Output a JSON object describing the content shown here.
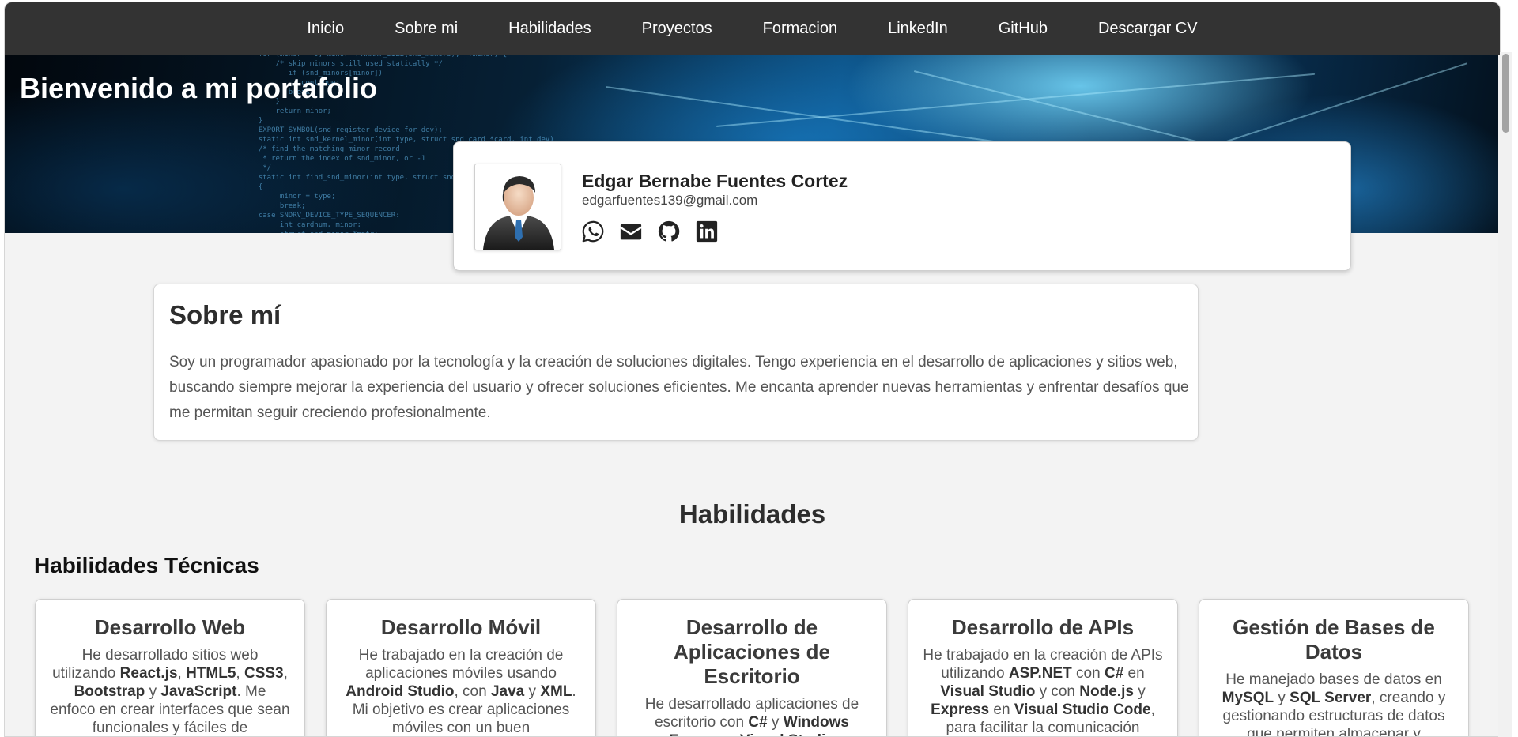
{
  "nav": {
    "items": [
      {
        "label": "Inicio"
      },
      {
        "label": "Sobre mi"
      },
      {
        "label": "Habilidades"
      },
      {
        "label": "Proyectos"
      },
      {
        "label": "Formacion"
      },
      {
        "label": "LinkedIn"
      },
      {
        "label": "GitHub"
      },
      {
        "label": "Descargar CV"
      }
    ]
  },
  "hero": {
    "title": "Bienvenido a mi portafolio"
  },
  "profile": {
    "name": "Edgar Bernabe Fuentes Cortez",
    "email": "edgarfuentes139@gmail.com",
    "social_icons": [
      "whatsapp-icon",
      "email-icon",
      "github-icon",
      "linkedin-icon"
    ]
  },
  "about": {
    "title": "Sobre mí",
    "text": "Soy un programador apasionado por la tecnología y la creación de soluciones digitales. Tengo experiencia en el desarrollo de aplicaciones y sitios web, buscando siempre mejorar la experiencia del usuario y ofrecer soluciones eficientes. Me encanta aprender nuevas herramientas y enfrentar desafíos que me permitan seguir creciendo profesionalmente."
  },
  "skills": {
    "title": "Habilidades",
    "subtitle": "Habilidades Técnicas",
    "cards": [
      {
        "title": "Desarrollo Web",
        "parts": [
          {
            "t": "He desarrollado sitios web utilizando "
          },
          {
            "t": "React.js",
            "b": true
          },
          {
            "t": ", "
          },
          {
            "t": "HTML5",
            "b": true
          },
          {
            "t": ", "
          },
          {
            "t": "CSS3",
            "b": true
          },
          {
            "t": ", "
          },
          {
            "t": "Bootstrap",
            "b": true
          },
          {
            "t": " y "
          },
          {
            "t": "JavaScript",
            "b": true
          },
          {
            "t": ". Me enfoco en crear interfaces que sean funcionales y fáciles de"
          }
        ]
      },
      {
        "title": "Desarrollo Móvil",
        "parts": [
          {
            "t": "He trabajado en la creación de aplicaciones móviles usando "
          },
          {
            "t": "Android Studio",
            "b": true
          },
          {
            "t": ", con "
          },
          {
            "t": "Java",
            "b": true
          },
          {
            "t": " y "
          },
          {
            "t": "XML",
            "b": true
          },
          {
            "t": ". Mi objetivo es crear aplicaciones móviles con un buen"
          }
        ]
      },
      {
        "title": "Desarrollo de Aplicaciones de Escritorio",
        "parts": [
          {
            "t": "He desarrollado aplicaciones de escritorio con "
          },
          {
            "t": "C#",
            "b": true
          },
          {
            "t": " y "
          },
          {
            "t": "Windows",
            "b": true
          },
          {
            "t": " "
          },
          {
            "t": "Forms",
            "b": true
          },
          {
            "t": " en "
          },
          {
            "t": "Visual Studio",
            "b": true
          }
        ]
      },
      {
        "title": "Desarrollo de APIs",
        "parts": [
          {
            "t": "He trabajado en la creación de APIs utilizando "
          },
          {
            "t": "ASP.NET",
            "b": true
          },
          {
            "t": " con "
          },
          {
            "t": "C#",
            "b": true
          },
          {
            "t": " en "
          },
          {
            "t": "Visual Studio",
            "b": true
          },
          {
            "t": " y con "
          },
          {
            "t": "Node.js",
            "b": true
          },
          {
            "t": " y "
          },
          {
            "t": "Express",
            "b": true
          },
          {
            "t": " en "
          },
          {
            "t": "Visual Studio Code",
            "b": true
          },
          {
            "t": ", para facilitar la comunicación"
          }
        ]
      },
      {
        "title": "Gestión de Bases de Datos",
        "parts": [
          {
            "t": "He manejado bases de datos en "
          },
          {
            "t": "MySQL",
            "b": true
          },
          {
            "t": " y "
          },
          {
            "t": "SQL Server",
            "b": true
          },
          {
            "t": ", creando y gestionando estructuras de datos que permiten almacenar y"
          }
        ]
      }
    ]
  },
  "colors": {
    "nav_bg": "#333333",
    "page_bg": "#f3f3f3",
    "card_bg": "#ffffff"
  }
}
